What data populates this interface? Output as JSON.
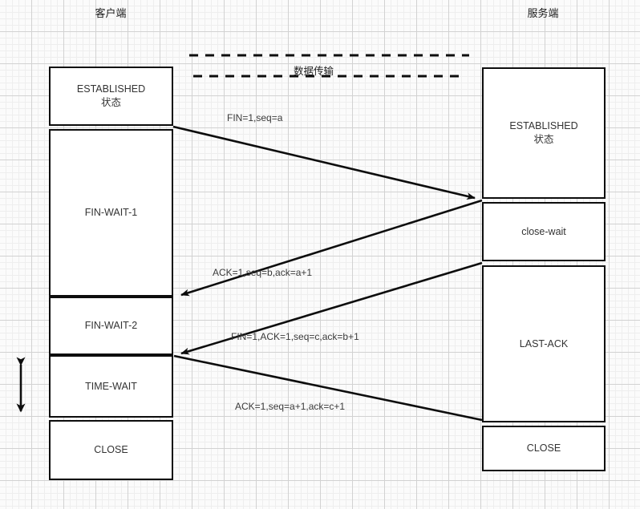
{
  "diagram": {
    "title": "TCP four-way handshake (connection termination)",
    "background": "#fbfbfb",
    "line_color": "#0d0d0d",
    "grid_color": "#d2d2d2"
  },
  "columns": {
    "client": "客户端",
    "server": "服务端"
  },
  "data_transfer": {
    "label": "数据传输"
  },
  "client_states": [
    {
      "label": "ESTABLISHED\n状态"
    },
    {
      "label": "FIN-WAIT-1"
    },
    {
      "label": "FIN-WAIT-2"
    },
    {
      "label": "TIME-WAIT"
    },
    {
      "label": "CLOSE"
    }
  ],
  "server_states": [
    {
      "label": "ESTABLISHED\n状态"
    },
    {
      "label": "close-wait"
    },
    {
      "label": "LAST-ACK"
    },
    {
      "label": "CLOSE"
    }
  ],
  "messages": [
    {
      "text": "FIN=1,seq=a"
    },
    {
      "text": "ACK=1,seq=b,ack=a+1"
    },
    {
      "text": "FIN=1,ACK=1,seq=c,ack=b+1"
    },
    {
      "text": "ACK=1,seq=a+1,ack=c+1"
    }
  ]
}
